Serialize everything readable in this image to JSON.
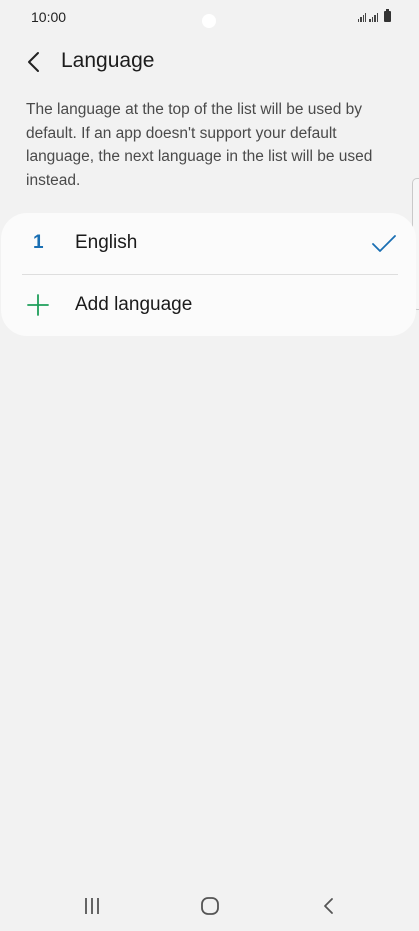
{
  "status_bar": {
    "time": "10:00"
  },
  "header": {
    "title": "Language",
    "back_icon": "chevron-left-icon"
  },
  "description": "The language at the top of the list will be used by default. If an app doesn't support your default language, the next language in the list will be used instead.",
  "languages": [
    {
      "number": "1",
      "name": "English",
      "selected": true
    }
  ],
  "add_language": {
    "label": "Add language"
  },
  "colors": {
    "accent_blue": "#1a6fb3",
    "add_green": "#1e9e5a",
    "background": "#f2f2f2",
    "card": "#fbfbfb"
  },
  "nav_icons": [
    "recents-icon",
    "home-icon",
    "back-icon"
  ]
}
